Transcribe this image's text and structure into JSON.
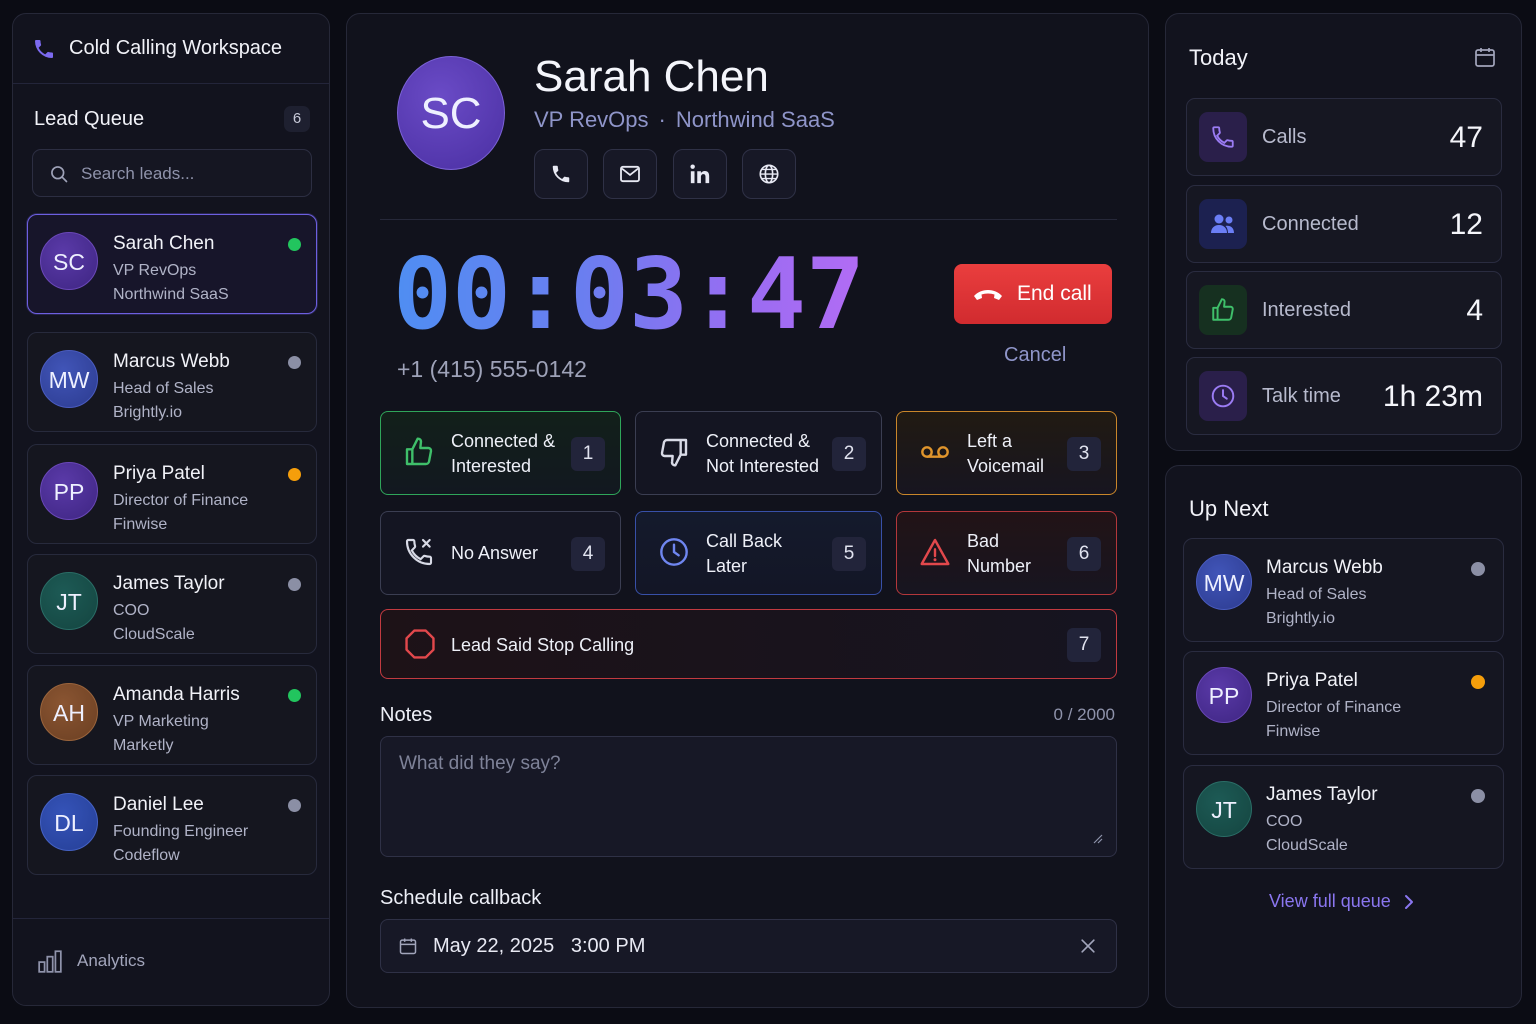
{
  "app": {
    "title": "Cold Calling Workspace"
  },
  "colors": {
    "accent": "#8a76f0",
    "online": "#22c55e",
    "busy": "#f59e0b",
    "offline": "#8b8fa5",
    "danger": "#e03535"
  },
  "sidebar": {
    "queue_title": "Lead Queue",
    "queue_count": "6",
    "search_placeholder": "Search leads...",
    "leads": [
      {
        "initials": "SC",
        "name": "Sarah Chen",
        "role": "VP RevOps",
        "company": "Northwind SaaS",
        "status": "online"
      },
      {
        "initials": "MW",
        "name": "Marcus Webb",
        "role": "Head of Sales",
        "company": "Brightly.io",
        "status": "offline"
      },
      {
        "initials": "PP",
        "name": "Priya Patel",
        "role": "Director of Finance",
        "company": "Finwise",
        "status": "busy"
      },
      {
        "initials": "JT",
        "name": "James Taylor",
        "role": "COO",
        "company": "CloudScale",
        "status": "offline"
      },
      {
        "initials": "AH",
        "name": "Amanda Harris",
        "role": "VP Marketing",
        "company": "Marketly",
        "status": "online"
      },
      {
        "initials": "DL",
        "name": "Daniel Lee",
        "role": "Founding Engineer",
        "company": "Codeflow",
        "status": "offline"
      }
    ],
    "footer_label": "Analytics"
  },
  "contact": {
    "initials": "SC",
    "name": "Sarah Chen",
    "title": "VP RevOps",
    "separator": "·",
    "company": "Northwind SaaS",
    "actions": [
      "phone-icon",
      "mail-icon",
      "linkedin-icon",
      "globe-icon"
    ]
  },
  "call": {
    "timer": "00:03:47",
    "phone": "+1 (415) 555-0142",
    "end_label": "End call",
    "cancel_label": "Cancel"
  },
  "outcomes": [
    {
      "line1": "Connected &",
      "line2": "Interested",
      "key": "1"
    },
    {
      "line1": "Connected &",
      "line2": "Not Interested",
      "key": "2"
    },
    {
      "line1": "Left a",
      "line2": "Voicemail",
      "key": "3"
    },
    {
      "line1": "No Answer",
      "line2": "",
      "key": "4"
    },
    {
      "line1": "Call Back",
      "line2": "Later",
      "key": "5"
    },
    {
      "line1": "Bad",
      "line2": "Number",
      "key": "6"
    },
    {
      "line1": "Lead Said Stop Calling",
      "line2": "",
      "key": "7"
    }
  ],
  "notes": {
    "label": "Notes",
    "count": "0 / 2000",
    "placeholder": "What did they say?"
  },
  "schedule": {
    "label": "Schedule callback",
    "date": "May 22, 2025",
    "time": "3:00 PM"
  },
  "today": {
    "title": "Today",
    "stats": [
      {
        "label": "Calls",
        "value": "47",
        "icon": "phone-icon"
      },
      {
        "label": "Connected",
        "value": "12",
        "icon": "users-icon"
      },
      {
        "label": "Interested",
        "value": "4",
        "icon": "thumbs-up-icon"
      },
      {
        "label": "Talk time",
        "value": "1h 23m",
        "icon": "clock-icon"
      }
    ]
  },
  "up_next": {
    "title": "Up Next",
    "leads": [
      {
        "initials": "MW",
        "name": "Marcus Webb",
        "role": "Head of Sales",
        "company": "Brightly.io",
        "status": "offline"
      },
      {
        "initials": "PP",
        "name": "Priya Patel",
        "role": "Director of Finance",
        "company": "Finwise",
        "status": "busy"
      },
      {
        "initials": "JT",
        "name": "James Taylor",
        "role": "COO",
        "company": "CloudScale",
        "status": "offline"
      }
    ],
    "view_all_label": "View full queue"
  }
}
